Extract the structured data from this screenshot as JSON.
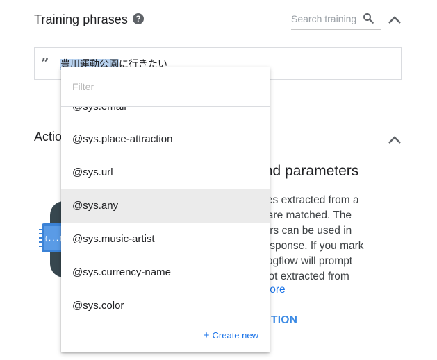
{
  "training": {
    "title": "Training phrases",
    "help_glyph": "?",
    "search_placeholder": "Search training",
    "phrase": {
      "highlighted": "豊川運動公園",
      "rest": "に行きたい"
    }
  },
  "action": {
    "title_partial": "Actio",
    "heading_partial": "on and parameters",
    "body_lines": [
      "ic values extracted from a",
      "ntities are matched. The",
      "rameters can be used in",
      "ng a response. If you mark",
      "d, Dialogflow will prompt",
      " were not extracted from"
    ],
    "learn_more": "earn more",
    "add_action": "ND ACTION"
  },
  "dropdown": {
    "filter_placeholder": "Filter",
    "items": [
      {
        "label": "@sys.email"
      },
      {
        "label": "@sys.place-attraction"
      },
      {
        "label": "@sys.url"
      },
      {
        "label": "@sys.any",
        "active": true
      },
      {
        "label": "@sys.music-artist"
      },
      {
        "label": "@sys.currency-name"
      },
      {
        "label": "@sys.color"
      }
    ],
    "create_new": "Create new",
    "create_plus": "+"
  },
  "icons": {
    "help": "help-circle-icon",
    "search": "search-icon",
    "collapse": "chevron-up-icon",
    "quote": "quote-icon"
  },
  "colors": {
    "link": "#1a73e8",
    "highlight": "#b9d3f0",
    "active_item": "#ebebeb",
    "illustration": "#3b82d6"
  }
}
